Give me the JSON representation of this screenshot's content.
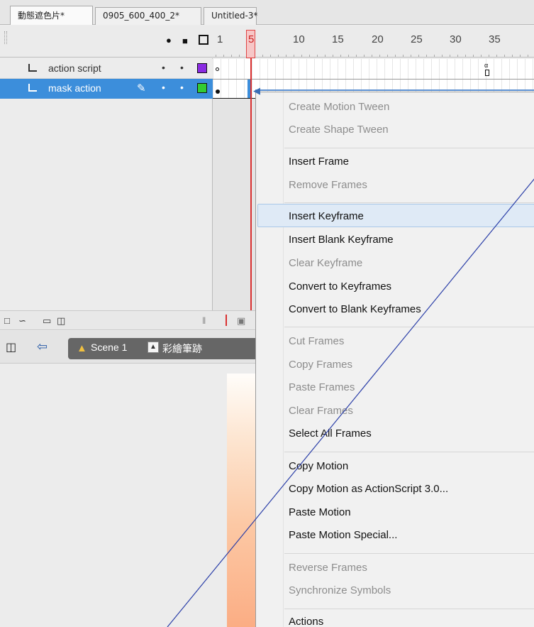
{
  "tabs": [
    "動態遮色片*",
    "0905_600_400_2*",
    "Untitled-3*"
  ],
  "timeline": {
    "frame_numbers": [
      "1",
      "10",
      "15",
      "20",
      "25",
      "30",
      "35"
    ],
    "current_frame": "5",
    "icons": {
      "eye": "eye-icon",
      "lock": "lock-icon",
      "outline": "outline-icon"
    }
  },
  "layers": [
    {
      "name": "action script",
      "color": "#8a2be2",
      "dot1": "•",
      "dot2": "•"
    },
    {
      "name": "mask action",
      "color": "#33cc33",
      "dot1": "•",
      "dot2": "•"
    }
  ],
  "frames": {
    "end_marker": "α"
  },
  "editbar": {
    "scene_label": "Scene 1",
    "symbol_label": "彩繪筆跡"
  },
  "context_menu": {
    "items": [
      {
        "label": "Create Motion Tween",
        "enabled": false
      },
      {
        "label": "Create Shape Tween",
        "enabled": false
      },
      {
        "label": "Insert Frame",
        "enabled": true
      },
      {
        "label": "Remove Frames",
        "enabled": false
      },
      {
        "label": "Insert Keyframe",
        "enabled": true,
        "highlighted": true
      },
      {
        "label": "Insert Blank Keyframe",
        "enabled": true
      },
      {
        "label": "Clear Keyframe",
        "enabled": false
      },
      {
        "label": "Convert to Keyframes",
        "enabled": true
      },
      {
        "label": "Convert to Blank Keyframes",
        "enabled": true
      },
      {
        "label": "Cut Frames",
        "enabled": false
      },
      {
        "label": "Copy Frames",
        "enabled": false
      },
      {
        "label": "Paste Frames",
        "enabled": false
      },
      {
        "label": "Clear Frames",
        "enabled": false
      },
      {
        "label": "Select All Frames",
        "enabled": true
      },
      {
        "label": "Copy Motion",
        "enabled": true
      },
      {
        "label": "Copy Motion as ActionScript 3.0...",
        "enabled": true
      },
      {
        "label": "Paste Motion",
        "enabled": true
      },
      {
        "label": "Paste Motion Special...",
        "enabled": true
      },
      {
        "label": "Reverse Frames",
        "enabled": false
      },
      {
        "label": "Synchronize Symbols",
        "enabled": false
      },
      {
        "label": "Actions",
        "enabled": true
      }
    ]
  },
  "colors": {
    "selection_blue": "#3c8edb",
    "playhead_red": "#d93030",
    "annotation_line": "#2b3fa8"
  }
}
